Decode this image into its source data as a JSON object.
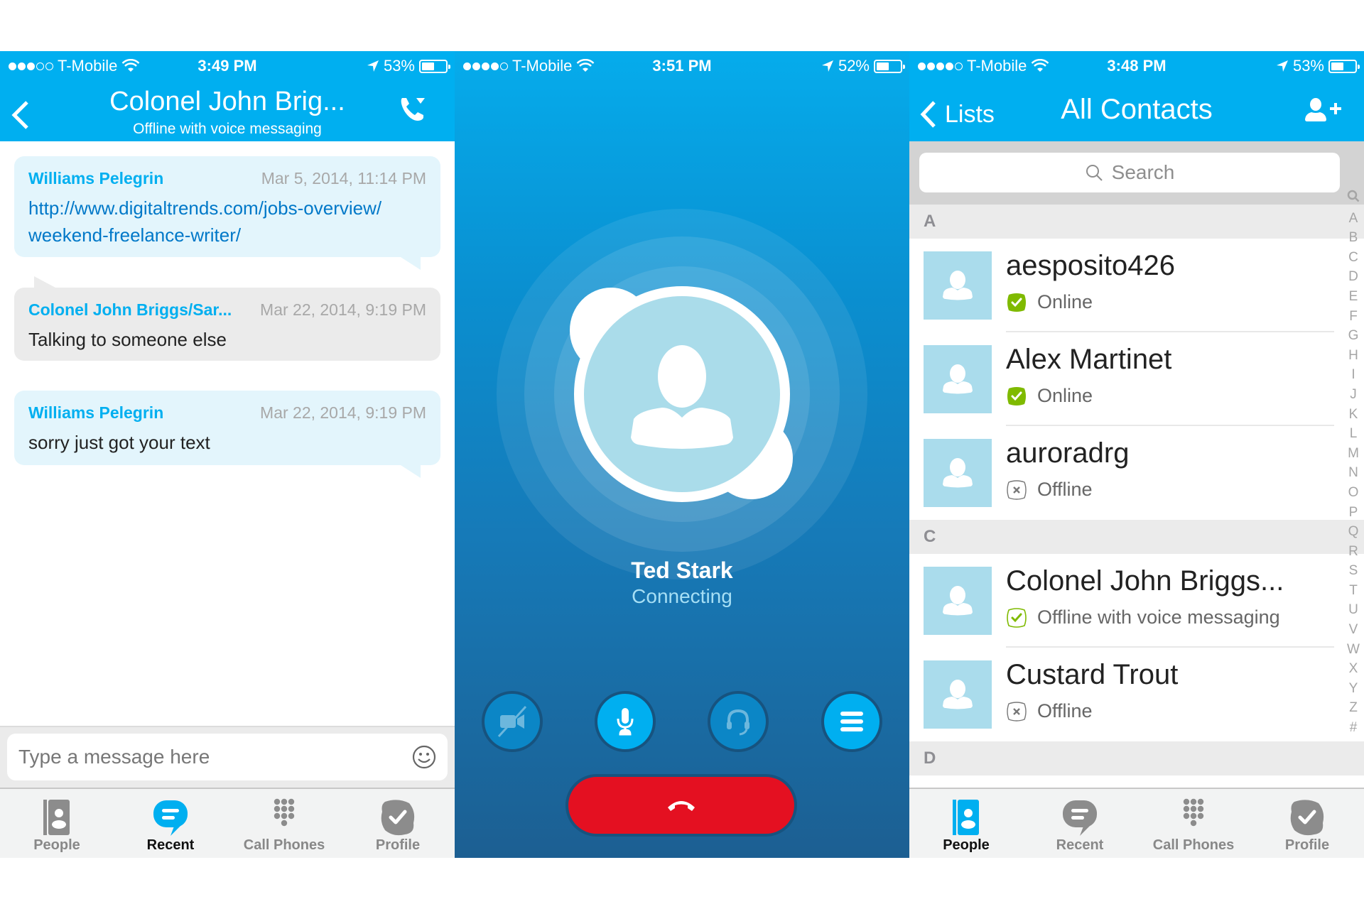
{
  "panels": {
    "chat": {
      "status": {
        "signal_bars": 3,
        "signal_total": 5,
        "carrier": "T-Mobile",
        "time": "3:49 PM",
        "battery": "53%",
        "battery_level": 0.53
      },
      "header": {
        "title": "Colonel John Brig...",
        "subtitle": "Offline with voice messaging",
        "back_icon": "chevron-left-icon",
        "call_icon": "phone-dropdown-icon"
      },
      "messages": [
        {
          "from": "Williams Pelegrin",
          "timestamp": "Mar 5, 2014, 11:14 PM",
          "text": "http://www.digitaltrends.com/jobs-overview/ weekend-freelance-writer/",
          "is_link": true,
          "side": "mine"
        },
        {
          "from": "Colonel John Briggs/Sar...",
          "timestamp": "Mar 22, 2014, 9:19 PM",
          "text": "Talking to someone else",
          "is_link": false,
          "side": "theirs"
        },
        {
          "from": "Williams Pelegrin",
          "timestamp": "Mar 22, 2014, 9:19 PM",
          "text": "sorry just got your text",
          "is_link": false,
          "side": "mine"
        }
      ],
      "composer": {
        "placeholder": "Type a message here",
        "value": "",
        "emoji_icon": "smiley-icon"
      },
      "tabs": [
        {
          "label": "People",
          "icon": "contacts-book-icon",
          "active": false
        },
        {
          "label": "Recent",
          "icon": "chat-bubble-icon",
          "active": true
        },
        {
          "label": "Call Phones",
          "icon": "dialpad-icon",
          "active": false
        },
        {
          "label": "Profile",
          "icon": "skype-check-icon",
          "active": false
        }
      ]
    },
    "call": {
      "status": {
        "signal_bars": 4,
        "signal_total": 5,
        "carrier": "T-Mobile",
        "time": "3:51 PM",
        "battery": "52%",
        "battery_level": 0.52
      },
      "contact_name": "Ted Stark",
      "call_state": "Connecting",
      "controls": [
        {
          "name": "video-off",
          "icon": "video-off-icon",
          "active": false
        },
        {
          "name": "mute",
          "icon": "microphone-icon",
          "active": true
        },
        {
          "name": "audio-route",
          "icon": "headset-icon",
          "active": false
        },
        {
          "name": "more",
          "icon": "menu-icon",
          "active": true
        }
      ],
      "end_call_icon": "hang-up-icon"
    },
    "contacts": {
      "status": {
        "signal_bars": 4,
        "signal_total": 5,
        "carrier": "T-Mobile",
        "time": "3:48 PM",
        "battery": "53%",
        "battery_level": 0.53
      },
      "header": {
        "back_label": "Lists",
        "title": "All Contacts",
        "add_icon": "add-contact-icon"
      },
      "search": {
        "placeholder": "Search"
      },
      "sections": [
        {
          "letter": "A",
          "contacts": [
            {
              "name": "aesposito426",
              "status": "Online",
              "status_type": "online"
            },
            {
              "name": "Alex Martinet",
              "status": "Online",
              "status_type": "online"
            },
            {
              "name": "auroradrg",
              "status": "Offline",
              "status_type": "offline"
            }
          ]
        },
        {
          "letter": "C",
          "contacts": [
            {
              "name": "Colonel John Briggs...",
              "status": "Offline with voice messaging",
              "status_type": "voicemail"
            },
            {
              "name": "Custard Trout",
              "status": "Offline",
              "status_type": "offline"
            }
          ]
        },
        {
          "letter": "D",
          "contacts": []
        }
      ],
      "index": [
        "search",
        "A",
        "B",
        "C",
        "D",
        "E",
        "F",
        "G",
        "H",
        "I",
        "J",
        "K",
        "L",
        "M",
        "N",
        "O",
        "P",
        "Q",
        "R",
        "S",
        "T",
        "U",
        "V",
        "W",
        "X",
        "Y",
        "Z",
        "#"
      ],
      "tabs": [
        {
          "label": "People",
          "icon": "contacts-book-icon",
          "active": true
        },
        {
          "label": "Recent",
          "icon": "chat-bubble-icon",
          "active": false
        },
        {
          "label": "Call Phones",
          "icon": "dialpad-icon",
          "active": false
        },
        {
          "label": "Profile",
          "icon": "skype-check-icon",
          "active": false
        }
      ]
    }
  },
  "colors": {
    "brand_blue": "#00aff0",
    "online_green": "#7fba00",
    "end_call_red": "#e41021",
    "avatar_bg": "#aadcec"
  }
}
